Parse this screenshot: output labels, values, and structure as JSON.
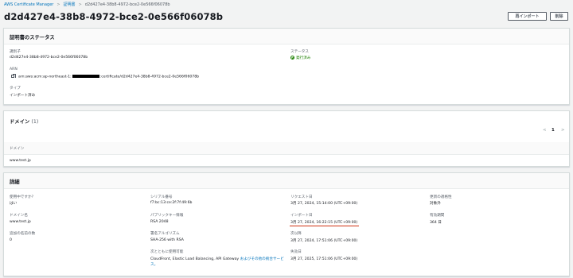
{
  "breadcrumb": {
    "root": "AWS Certificate Manager",
    "parent": "証明書",
    "current": "d2d427e4-38b8-4972-bce2-0e566f06078b"
  },
  "page": {
    "title": "d2d427e4-38b8-4972-bce2-0e566f06078b",
    "reimport_label": "再インポート",
    "delete_label": "削除"
  },
  "status_panel": {
    "title": "証明書のステータス",
    "id_label": "識別子",
    "id_value": "d2d427e4-38b8-4972-bce2-0e566f06078b",
    "status_label": "ステータス",
    "status_value": "発行済み",
    "arn_label": "ARN",
    "arn_prefix": "arn:aws:acm:ap-northeast-1:",
    "arn_suffix": ":certificate/d2d427e4-38b8-4972-bce2-0e566f06078b",
    "type_label": "タイプ",
    "type_value": "インポート済み"
  },
  "domains_panel": {
    "title": "ドメイン",
    "count": "(1)",
    "page_number": "1",
    "column_header": "ドメイン",
    "rows": [
      "www.test.jp"
    ]
  },
  "details_panel": {
    "title": "詳細",
    "in_use_label": "使用中ですか?",
    "in_use_value": "はい",
    "domain_name_label": "ドメイン名",
    "domain_name_value": "www.test.jp",
    "additional_names_label": "追加の名前の数",
    "additional_names_value": "0",
    "serial_label": "シリアル番号",
    "serial_value": "f7:bc:13:ce:2f:7f:49:6b",
    "public_key_label": "パブリックキー情報",
    "public_key_value": "RSA 2048",
    "signature_label": "署名アルゴリズム",
    "signature_value": "SHA-256 with RSA",
    "usable_with_label": "次とともに使用可能",
    "usable_with_value": "CloudFront, Elastic Load Balancing, API Gateway",
    "usable_with_link": "およびその他の統合サービス。",
    "requested_label": "リクエスト日",
    "requested_value": "3月 27, 2024, 15:14:00 (UTC+09:00)",
    "imported_label": "インポート日",
    "imported_value": "3月 27, 2024, 16:22:15 (UTC+09:00)",
    "not_before_label": "次以降",
    "not_before_value": "3月 27, 2024, 17:51:06 (UTC+09:00)",
    "not_after_label": "失効日",
    "not_after_value": "3月 27, 2025, 17:51:06 (UTC+09:00)",
    "renewal_label": "更新の適格性",
    "renewal_value": "対象外",
    "validity_label": "有効期間",
    "validity_value": "364 日"
  },
  "colors": {
    "link": "#0073bb",
    "success": "#1d8102",
    "underline": "#d13212"
  },
  "icons": [
    "copy-icon",
    "check-circle-icon",
    "chevron-left-icon",
    "chevron-right-icon"
  ]
}
